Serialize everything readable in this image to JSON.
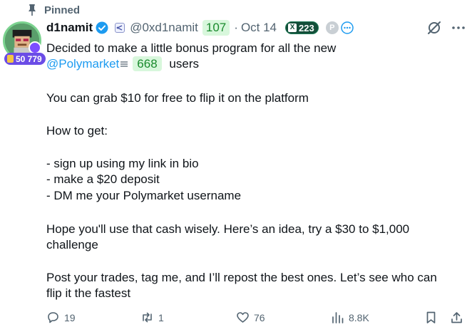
{
  "pinned": {
    "label": "Pinned"
  },
  "author": {
    "display_name": "d1namit",
    "handle": "@0xd1namit",
    "handle_badge": "107",
    "date": "Oct 14",
    "x_badge_count": "223",
    "score": "50 779",
    "x_badge_glyph": "X",
    "p_badge_glyph": "P"
  },
  "tweet": {
    "line1": "Decided to make a little bonus program for all the new",
    "mention": "@Polymarket",
    "mention_badge": "668",
    "line2_tail": "users",
    "paragraph2": "You can grab $10 for free to flip it on the platform",
    "paragraph3": "How to get:",
    "list": [
      "- sign up using my link in bio",
      "- make a $20 deposit",
      "- DM me your Polymarket username"
    ],
    "paragraph4_line1": "Hope you'll use that cash wisely. Here’s an idea, try a $30 to $1,000",
    "paragraph4_line2": "challenge",
    "paragraph5_line1": "Post your trades, tag me, and I’ll repost the best ones. Let’s see who can",
    "paragraph5_line2": "flip it the fastest"
  },
  "actions": {
    "replies": "19",
    "reposts": "1",
    "likes": "76",
    "views": "8.8K"
  },
  "icons": {
    "pinned": "pin-icon",
    "verified": "verified-badge-icon",
    "ext": "extension-icon",
    "dots": "dots-circle-icon",
    "grok": "grok-icon",
    "more": "more-icon",
    "reply": "reply-icon",
    "repost": "repost-icon",
    "like": "heart-icon",
    "views": "views-icon",
    "bookmark": "bookmark-icon",
    "share": "share-icon"
  },
  "colors": {
    "accent_blue": "#1d9bf0",
    "muted_text": "#536471",
    "green_badge_bg": "#d8f7dc",
    "green_badge_text": "#1a8a2d",
    "score_pill": "#6b4ce6"
  }
}
